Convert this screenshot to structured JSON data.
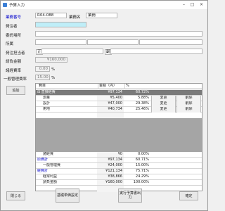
{
  "window": {
    "title": "予算入力"
  },
  "form": {
    "project_no_label": "業務番号",
    "project_no_value": "R04-088",
    "project_name_label": "業務名",
    "project_name_value": "業務",
    "client_label": "発注者",
    "location_label": "委託場所",
    "office_label": "所属",
    "person_label": "発注担当者",
    "person_main_prefix": "正",
    "person_sub_prefix": "副",
    "contract_amount_label": "請負金額",
    "contract_amount_value": "¥160,000",
    "expense_rate_label": "諸経費率",
    "expense_rate_value": "0.00",
    "general_rate_label": "一般管理費率",
    "general_rate_value": "15.00",
    "percent_unit": "%"
  },
  "buttons": {
    "add": "追加",
    "close": "閉じる",
    "unit_price": "基礎単価設定",
    "print": "実行予算書出力",
    "confirm": "確定"
  },
  "grid": {
    "headers": [
      "費目",
      "金額（円）",
      "%"
    ],
    "change_label": "変更",
    "delete_label": "削除",
    "rows": [
      {
        "name": "直接経費",
        "amount": "¥97,134",
        "pct": "60.72%",
        "style": "sel",
        "expand": "⊟"
      },
      {
        "name": "測量",
        "amount": "¥5,400",
        "pct": "5.88%",
        "style": "item"
      },
      {
        "name": "設計",
        "amount": "¥47,000",
        "pct": "29.38%",
        "style": "item"
      },
      {
        "name": "用地",
        "amount": "¥40,734",
        "pct": "25.46%",
        "style": "item"
      },
      {
        "name": "諸経費",
        "amount": "¥0",
        "pct": "0.00%",
        "style": "plain"
      },
      {
        "name": "原価計",
        "amount": "¥97,134",
        "pct": "60.71%",
        "style": "blue"
      },
      {
        "name": "一般管理費",
        "amount": "¥24,000",
        "pct": "15.00%",
        "style": "plain"
      },
      {
        "name": "経費計",
        "amount": "¥121,134",
        "pct": "75.71%",
        "style": "blue"
      },
      {
        "name": "経常利益",
        "amount": "¥38,866",
        "pct": "24.29%",
        "style": "plain"
      },
      {
        "name": "請負金額",
        "amount": "¥160,000",
        "pct": "100.00%",
        "style": "plain"
      }
    ]
  }
}
